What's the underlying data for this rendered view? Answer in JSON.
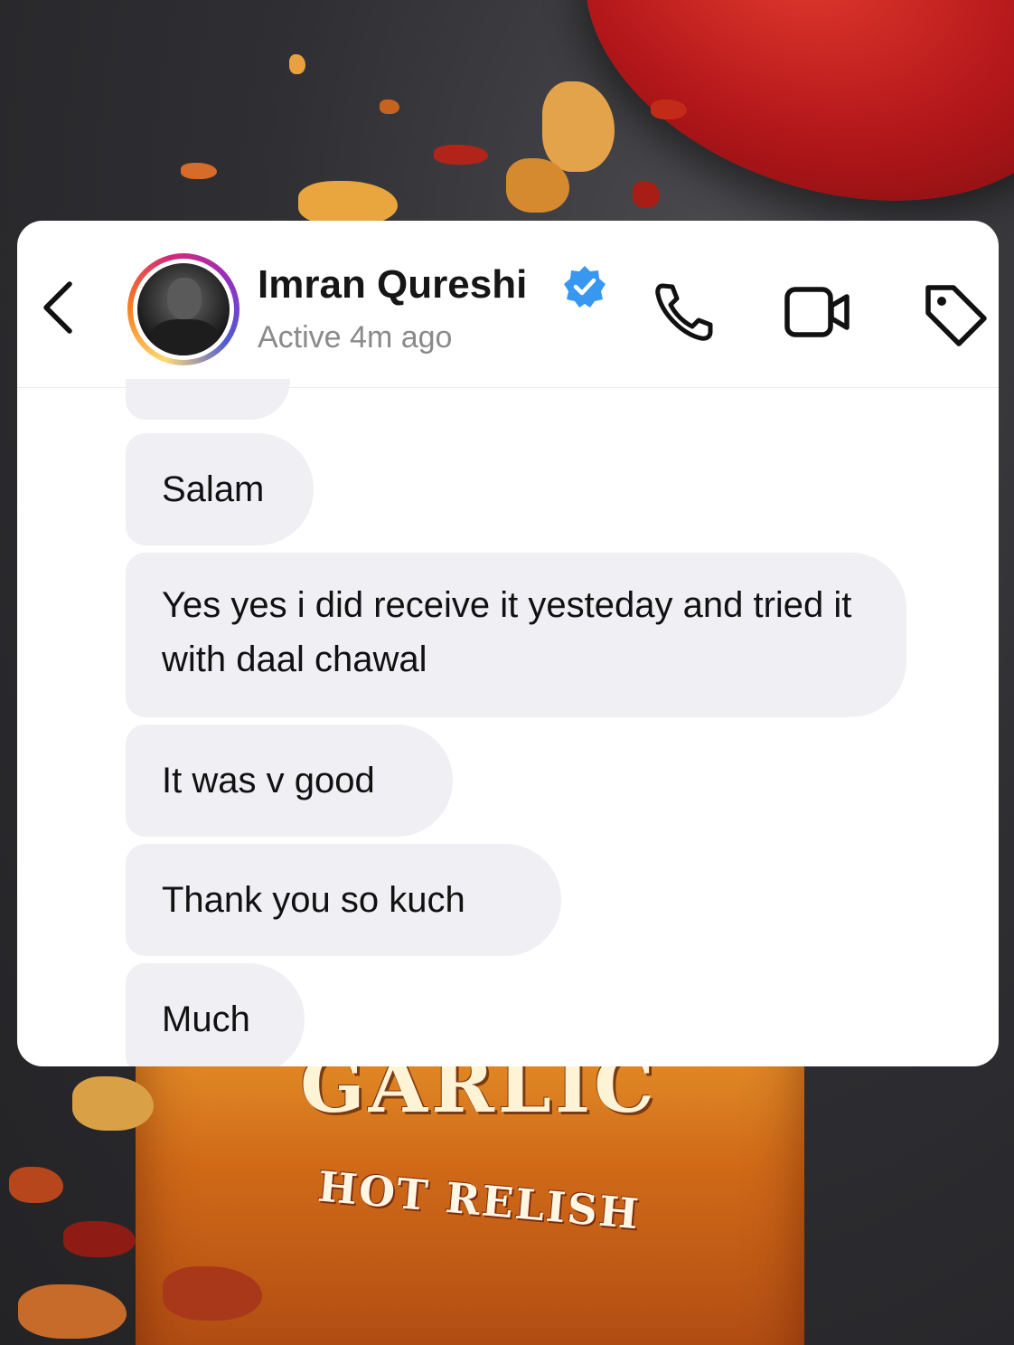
{
  "header": {
    "contact_name": "Imran Qureshi",
    "status": "Active 4m ago",
    "verified": true,
    "icons": [
      "back-chevron-icon",
      "phone-icon",
      "video-camera-icon",
      "tag-icon"
    ]
  },
  "messages": [
    {
      "text": "Salam"
    },
    {
      "text": "Yes yes i did receive it yesteday and tried it with daal chawal"
    },
    {
      "text": "It was v good"
    },
    {
      "text": "Thank you so kuch"
    },
    {
      "text": "Much"
    }
  ],
  "background": {
    "product_name": "GARLIC",
    "product_subtitle": "HOT RELISH"
  },
  "colors": {
    "verified_blue": "#3897f0",
    "bubble_bg": "#efeff4",
    "lid_red": "#c41e1e",
    "jar_orange": "#e07a1f"
  }
}
